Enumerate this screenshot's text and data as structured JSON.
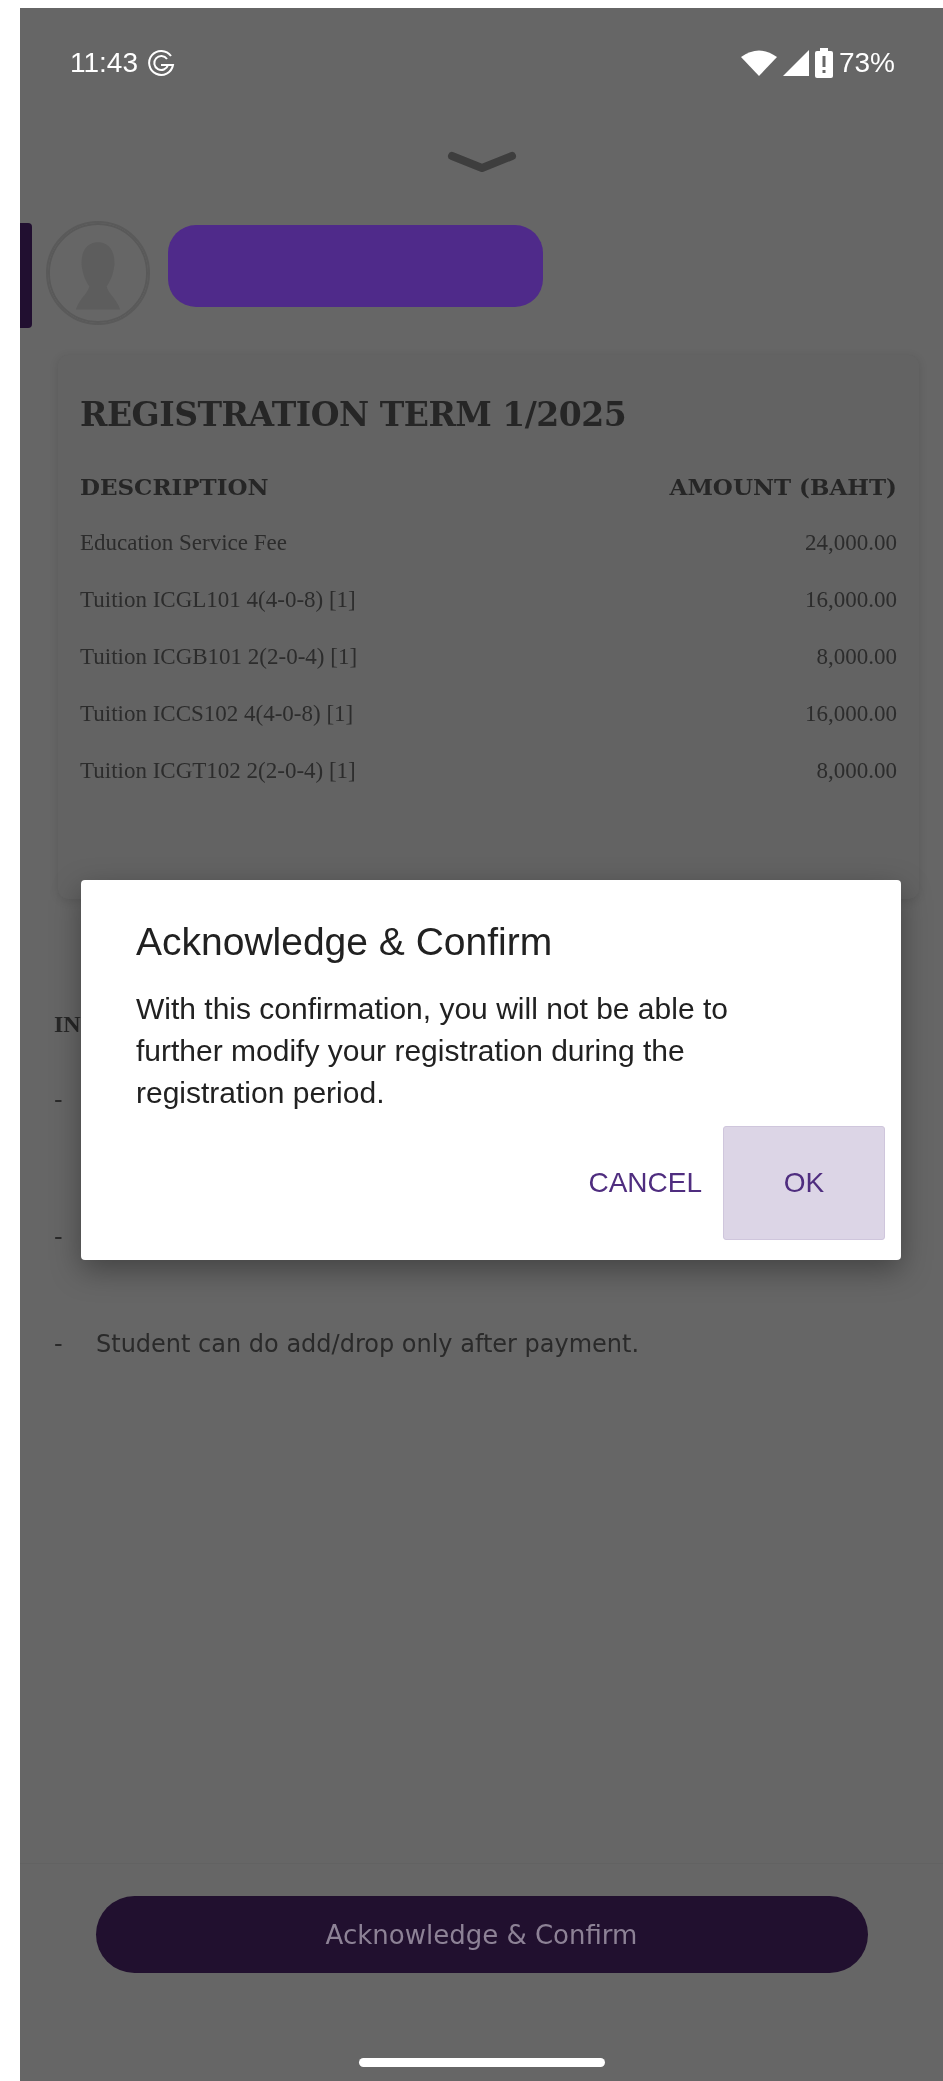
{
  "status_bar": {
    "time": "11:43",
    "battery": "73%"
  },
  "registration": {
    "title": "REGISTRATION TERM 1/2025",
    "columns": [
      "DESCRIPTION",
      "AMOUNT (BAHT)"
    ],
    "rows": [
      {
        "description": "Education Service Fee",
        "amount": "24,000.00"
      },
      {
        "description": "Tuition ICGL101 4(4-0-8) [1]",
        "amount": "16,000.00"
      },
      {
        "description": "Tuition ICGB101 2(2-0-4) [1]",
        "amount": "8,000.00"
      },
      {
        "description": "Tuition ICCS102 4(4-0-8) [1]",
        "amount": "16,000.00"
      },
      {
        "description": "Tuition ICGT102 2(2-0-4) [1]",
        "amount": "8,000.00"
      }
    ]
  },
  "info": {
    "heading": "IN",
    "notes": [
      {
        "bullet": "-"
      },
      {
        "bullet": "-"
      },
      {
        "bullet": "-",
        "text": "Student can do add/drop only after payment."
      }
    ]
  },
  "dialog": {
    "title": "Acknowledge & Confirm",
    "message": "With this confirmation, you will not be able to further modify your registration during the registration period.",
    "buttons": [
      {
        "label": "CANCEL",
        "focused": false
      },
      {
        "label": "OK",
        "focused": true
      }
    ]
  },
  "footer_button": {
    "label": "Acknowledge & Confirm"
  }
}
